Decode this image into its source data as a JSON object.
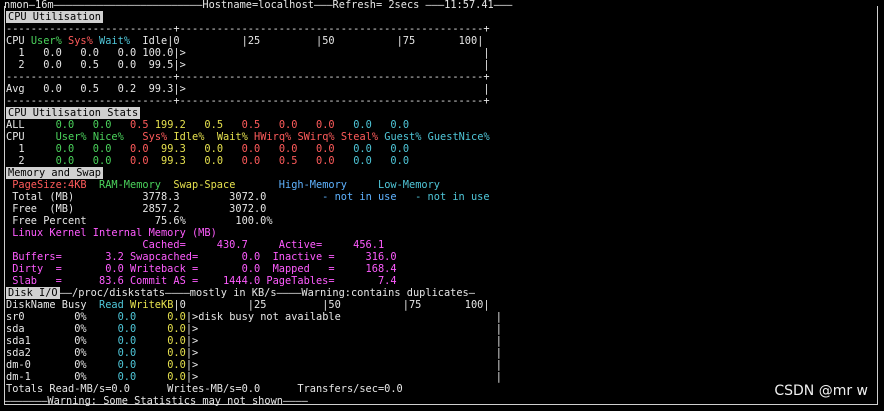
{
  "header": "nmon—16m————————————————————————Hostname=localhost———Refresh= 2secs ———11:57.41———",
  "cpu_util": {
    "title": "CPU Utilisation",
    "border": "---------------------------+-------------------------------------------------+",
    "head_cpu": "CPU ",
    "head_user": "User%",
    "head_sys": "Sys%",
    "head_wait": "Wait%",
    "head_rest": "  Idle|0          |25         |50          |75       100|",
    "rows": [
      "  1   0.0   0.0   0.0 100.0|>                                                |",
      "  2   0.0   0.5   0.0  99.5|>                                                |"
    ],
    "sep": "---------------------------+-------------------------------------------------+",
    "avg": "Avg   0.0   0.5   0.2  99.3|>                                                |",
    "bottom": "---------------------------+-------------------------------------------------+"
  },
  "cpu_stats": {
    "title": "CPU Utilisation Stats",
    "all_label": "ALL   ",
    "all_values": [
      {
        "t": "  0.0 ",
        "c": "g"
      },
      {
        "t": "  0.0 ",
        "c": "g"
      },
      {
        "t": "  0.5 ",
        "c": "r"
      },
      {
        "t": "199.2 ",
        "c": "y"
      },
      {
        "t": "  0.5 ",
        "c": "y"
      },
      {
        "t": "  0.5 ",
        "c": "r"
      },
      {
        "t": "  0.0 ",
        "c": "r"
      },
      {
        "t": "  0.0 ",
        "c": "r"
      },
      {
        "t": "  0.0 ",
        "c": "c"
      },
      {
        "t": "  0.0",
        "c": "c"
      }
    ],
    "hdr_label": "CPU   ",
    "headers": [
      {
        "t": "  User% ",
        "c": "g"
      },
      {
        "t": "Nice% ",
        "c": "g"
      },
      {
        "t": "  Sys% ",
        "c": "r"
      },
      {
        "t": "Idle% ",
        "c": "y"
      },
      {
        "t": " Wait% ",
        "c": "y"
      },
      {
        "t": "HWirq% ",
        "c": "r"
      },
      {
        "t": "SWirq% ",
        "c": "r"
      },
      {
        "t": "Steal% ",
        "c": "r"
      },
      {
        "t": "Guest% ",
        "c": "c"
      },
      {
        "t": "GuestNice%",
        "c": "c"
      }
    ],
    "rows": [
      {
        "label": "  1   ",
        "values": [
          {
            "t": "  0.0 ",
            "c": "g"
          },
          {
            "t": "  0.0 ",
            "c": "g"
          },
          {
            "t": "  0.0 ",
            "c": "r"
          },
          {
            "t": " 99.3 ",
            "c": "y"
          },
          {
            "t": "  0.0 ",
            "c": "y"
          },
          {
            "t": "  0.0 ",
            "c": "r"
          },
          {
            "t": "  0.0 ",
            "c": "r"
          },
          {
            "t": "  0.0 ",
            "c": "r"
          },
          {
            "t": "  0.0 ",
            "c": "c"
          },
          {
            "t": "  0.0",
            "c": "c"
          }
        ]
      },
      {
        "label": "  2   ",
        "values": [
          {
            "t": "  0.0 ",
            "c": "g"
          },
          {
            "t": "  0.0 ",
            "c": "g"
          },
          {
            "t": "  0.0 ",
            "c": "r"
          },
          {
            "t": " 99.3 ",
            "c": "y"
          },
          {
            "t": "  0.0 ",
            "c": "y"
          },
          {
            "t": "  0.0 ",
            "c": "r"
          },
          {
            "t": "  0.5 ",
            "c": "r"
          },
          {
            "t": "  0.0 ",
            "c": "r"
          },
          {
            "t": "  0.0 ",
            "c": "c"
          },
          {
            "t": "  0.0",
            "c": "c"
          }
        ]
      }
    ]
  },
  "memory": {
    "title": "Memory and Swap",
    "page_size": " PageSize:4KB",
    "ram_head": "  RAM-Memory",
    "swap_head": "  Swap-Space",
    "high_head": "       High-Memory",
    "low_head": "     Low-Memory",
    "total": " Total (MB)           3778.3        3072.0",
    "total_high": "         - not in use",
    "total_low": "   - not in use",
    "free": " Free  (MB)           2857.2        3072.0",
    "free_pct": " Free Percent           75.6%        100.0%",
    "kernel_title": " Linux Kernel Internal Memory (MB)",
    "k1": "                      Cached=     430.7     Active=     456.1",
    "k2": " Buffers=       3.2 Swapcached=       0.0  Inactive =     316.0",
    "k3": " Dirty  =       0.0 Writeback =       0.0  Mapped   =     168.4",
    "k4": " Slab   =      83.6 Commit AS =    1444.0 PageTables=       7.4"
  },
  "disk": {
    "title": "Disk I/O",
    "title_rest": "——/proc/diskstats————mostly in KB/s————Warning:contains duplicates—",
    "head_name": "DiskName Busy  ",
    "head_read": "Read ",
    "head_write": "WriteKB",
    "head_scale": "|0          |25         |50          |75       100|",
    "rows": [
      {
        "name": "sr0       ",
        "busy": " 0%     ",
        "read": "0.0     ",
        "write": "0.0",
        "bar": "|>disk busy not available                         |"
      },
      {
        "name": "sda       ",
        "busy": " 0%     ",
        "read": "0.0     ",
        "write": "0.0",
        "bar": "|>                                                |"
      },
      {
        "name": "sda1      ",
        "busy": " 0%     ",
        "read": "0.0     ",
        "write": "0.0",
        "bar": "|>                                                |"
      },
      {
        "name": "sda2      ",
        "busy": " 0%     ",
        "read": "0.0     ",
        "write": "0.0",
        "bar": "|>                                                |"
      },
      {
        "name": "dm-0      ",
        "busy": " 0%     ",
        "read": "0.0     ",
        "write": "0.0",
        "bar": "|>                                                |"
      },
      {
        "name": "dm-1      ",
        "busy": " 0%     ",
        "read": "0.0     ",
        "write": "0.0",
        "bar": "|>                                                |"
      }
    ],
    "totals": "Totals Read-MB/s=0.0      Writes-MB/s=0.0      Transfers/sec=0.0"
  },
  "footer": "———————Warning: Some Statistics may not shown————",
  "watermark": "CSDN @mr  w"
}
